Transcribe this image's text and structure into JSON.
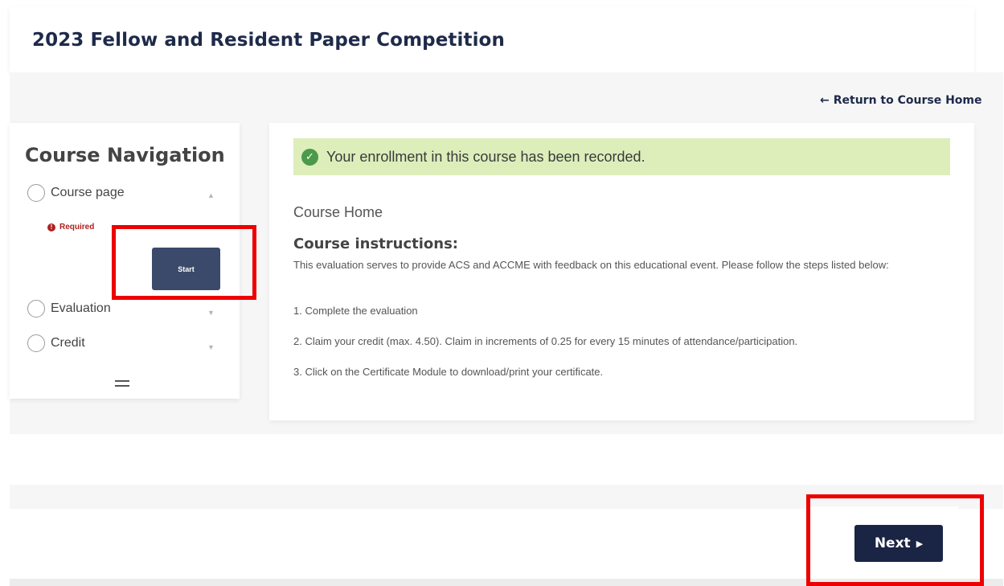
{
  "header": {
    "title": "2023 Fellow and Resident Paper Competition"
  },
  "return_link": {
    "arrow": "←",
    "label": "Return to Course Home"
  },
  "course_nav": {
    "title": "Course Navigation",
    "items": [
      {
        "label": "Course page",
        "chevron": "▲"
      },
      {
        "label": "Evaluation",
        "chevron": "▼"
      },
      {
        "label": "Credit",
        "chevron": "▼"
      }
    ],
    "required_icon": "!",
    "required_label": "Required",
    "start_label": "Start"
  },
  "alert": {
    "icon": "✓",
    "message": "Your enrollment in this course has been recorded."
  },
  "content": {
    "section_label": "Course Home",
    "instructions_heading": "Course instructions:",
    "instructions_intro": "This evaluation serves to provide ACS and ACCME with feedback on this educational event. Please follow the steps listed below:",
    "steps": [
      "1. Complete the evaluation",
      "2. Claim your credit (max. 4.50). Claim in increments of 0.25 for every 15 minutes of attendance/participation.",
      "3. Click on the Certificate Module to download/print your certificate."
    ]
  },
  "footer": {
    "next_label": "Next",
    "next_caret": "▶"
  },
  "colors": {
    "brand_navy": "#1a2444",
    "highlight_red": "#ee0000",
    "success_bg": "#ddeebb",
    "required_red": "#b02020"
  }
}
